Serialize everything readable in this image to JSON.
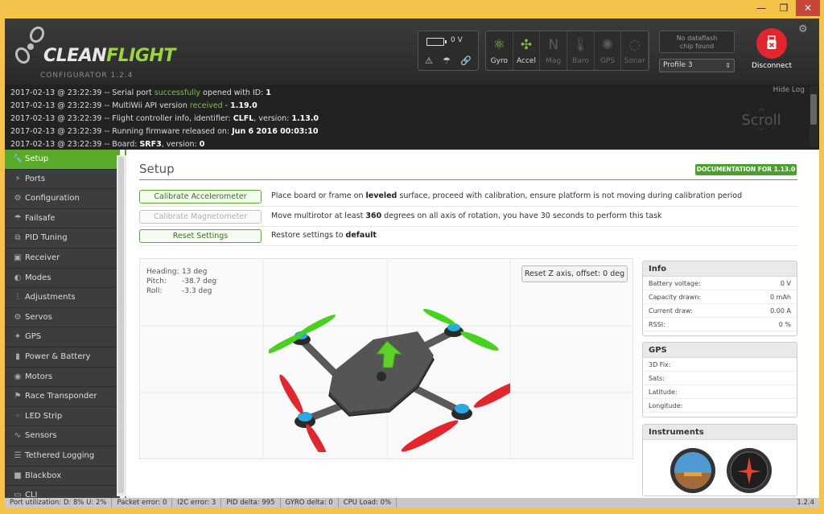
{
  "window": {
    "min_glyph": "—",
    "max_glyph": "❐",
    "close_glyph": "✕"
  },
  "header": {
    "logo_clean": "CLEAN",
    "logo_flight": "FLIGHT",
    "logo_version": "CONFIGURATOR  1.2.4",
    "battery_voltage": "0 V",
    "sensors": [
      {
        "label": "Gyro",
        "icon": "gyro-icon",
        "active": true
      },
      {
        "label": "Accel",
        "icon": "accel-icon",
        "active": true
      },
      {
        "label": "Mag",
        "icon": "mag-icon",
        "active": false
      },
      {
        "label": "Baro",
        "icon": "baro-icon",
        "active": false
      },
      {
        "label": "GPS",
        "icon": "gps-icon",
        "active": false
      },
      {
        "label": "Sonar",
        "icon": "sonar-icon",
        "active": false
      }
    ],
    "dataflash_line1": "No dataflash",
    "dataflash_line2": "chip found",
    "profile": "Profile 3",
    "disconnect_label": "Disconnect",
    "accent_red": "#e3262e"
  },
  "log": {
    "hide_label": "Hide Log",
    "scroll_label": "Scroll",
    "lines": [
      {
        "pre": "2017-02-13 @ 23:22:39 -- Serial port ",
        "hl": "successfully",
        "post": " opened with ID: ",
        "bold": "1"
      },
      {
        "pre": "2017-02-13 @ 23:22:39 -- MultiWii API version ",
        "hl": "received",
        "post": " - ",
        "bold": "1.19.0"
      },
      {
        "pre": "2017-02-13 @ 23:22:39 -- Flight controller info, identifier: ",
        "hl": "",
        "post": "",
        "bold": "CLFL",
        "post2": ", version: ",
        "bold2": "1.13.0"
      },
      {
        "pre": "2017-02-13 @ 23:22:39 -- Running firmware released on: ",
        "hl": "",
        "post": "",
        "bold": "Jun 6 2016 00:03:10"
      },
      {
        "pre": "2017-02-13 @ 23:22:39 -- Board: ",
        "hl": "",
        "post": "",
        "bold": "SRF3",
        "post2": ", version: ",
        "bold2": "0"
      }
    ]
  },
  "sidebar": {
    "items": [
      {
        "label": "Setup",
        "icon": "wrench-icon",
        "glyph": "🔧",
        "active": true
      },
      {
        "label": "Ports",
        "icon": "plug-icon",
        "glyph": "⚡"
      },
      {
        "label": "Configuration",
        "icon": "gear-icon",
        "glyph": "⚙"
      },
      {
        "label": "Failsafe",
        "icon": "parachute-icon",
        "glyph": "☂"
      },
      {
        "label": "PID Tuning",
        "icon": "sliders-icon",
        "glyph": "⧉"
      },
      {
        "label": "Receiver",
        "icon": "receiver-icon",
        "glyph": "▣"
      },
      {
        "label": "Modes",
        "icon": "toggle-icon",
        "glyph": "◐"
      },
      {
        "label": "Adjustments",
        "icon": "adjust-icon",
        "glyph": "⫶"
      },
      {
        "label": "Servos",
        "icon": "servo-icon",
        "glyph": "⚙"
      },
      {
        "label": "GPS",
        "icon": "satellite-icon",
        "glyph": "✦"
      },
      {
        "label": "Power & Battery",
        "icon": "battery-icon",
        "glyph": "▮"
      },
      {
        "label": "Motors",
        "icon": "motor-icon",
        "glyph": "◉"
      },
      {
        "label": "Race Transponder",
        "icon": "flag-icon",
        "glyph": "⚑"
      },
      {
        "label": "LED Strip",
        "icon": "led-icon",
        "glyph": "◦"
      },
      {
        "label": "Sensors",
        "icon": "graph-icon",
        "glyph": "∿"
      },
      {
        "label": "Tethered Logging",
        "icon": "tether-icon",
        "glyph": "☰"
      },
      {
        "label": "Blackbox",
        "icon": "blackbox-icon",
        "glyph": "■"
      },
      {
        "label": "CLI",
        "icon": "terminal-icon",
        "glyph": "▭"
      }
    ],
    "active_color": "#59aa29"
  },
  "setup": {
    "title": "Setup",
    "doc_button": "DOCUMENTATION FOR 1.13.0",
    "rows": [
      {
        "button": "Calibrate Accelerometer",
        "disabled": false,
        "d1": "Place board or frame on ",
        "b1": "leveled",
        "d2": " surface, proceed with calibration, ensure platform is not moving during calibration period",
        "b2": "",
        "d3": ""
      },
      {
        "button": "Calibrate Magnetometer",
        "disabled": true,
        "d1": "Move multirotor at least ",
        "b1": "360",
        "d2": " degrees on all axis of rotation, you have 30 seconds to perform this task",
        "b2": "",
        "d3": ""
      },
      {
        "button": "Reset Settings",
        "disabled": false,
        "d1": "Restore settings to ",
        "b1": "default",
        "d2": "",
        "b2": "",
        "d3": ""
      }
    ],
    "attitude": {
      "heading_label": "Heading:",
      "heading": "13 deg",
      "pitch_label": "Pitch:",
      "pitch": "-38.7 deg",
      "roll_label": "Roll:",
      "roll": "-3.3 deg"
    },
    "reset_z": "Reset Z axis, offset: 0 deg",
    "info": {
      "title": "Info",
      "rows": [
        {
          "label": "Battery voltage:",
          "value": "0 V"
        },
        {
          "label": "Capacity drawn:",
          "value": "0 mAh"
        },
        {
          "label": "Current draw:",
          "value": "0.00 A"
        },
        {
          "label": "RSSI:",
          "value": "0 %"
        }
      ]
    },
    "gps": {
      "title": "GPS",
      "rows": [
        {
          "label": "3D Fix:",
          "value": ""
        },
        {
          "label": "Sats:",
          "value": ""
        },
        {
          "label": "Latitude:",
          "value": ""
        },
        {
          "label": "Longitude:",
          "value": ""
        }
      ]
    },
    "instruments_title": "Instruments"
  },
  "status": {
    "items": [
      "Port utilization: D: 8% U: 2%",
      "Packet error: 0",
      "I2C error: 3",
      "PID delta: 995",
      "GYRO delta: 0",
      "CPU Load: 0%"
    ],
    "version": "1.2.4"
  }
}
